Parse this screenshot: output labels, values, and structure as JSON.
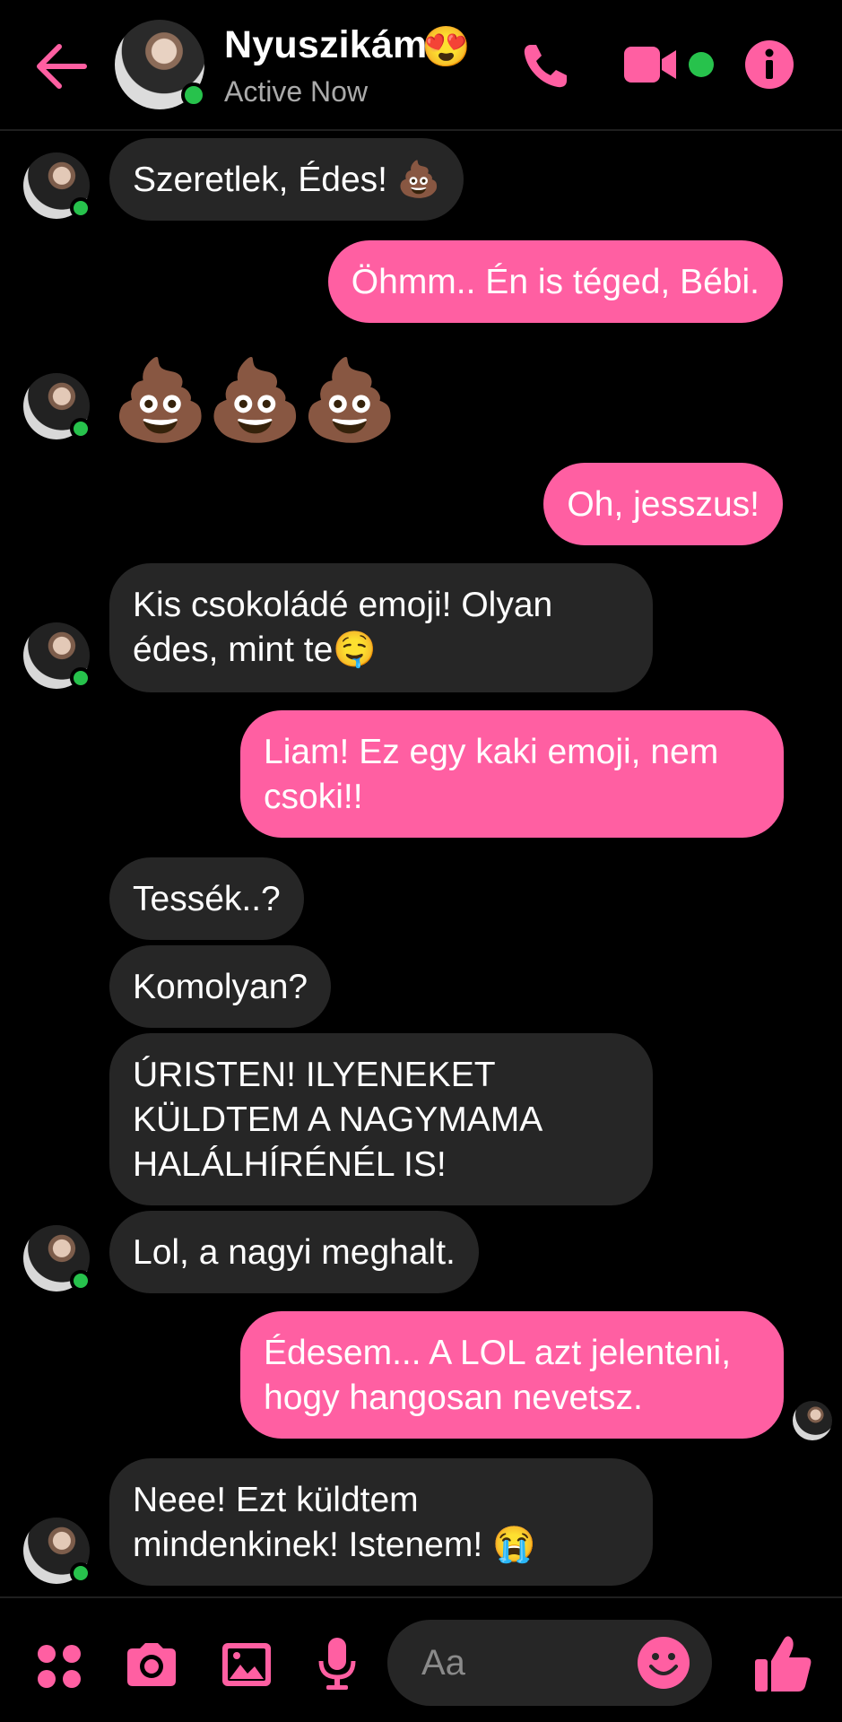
{
  "header": {
    "contact_name": "Nyuszikám",
    "name_emoji": "😍",
    "status": "Active Now"
  },
  "colors": {
    "accent": "#ff5fa2",
    "online": "#27c24c",
    "incoming_bubble": "#262626"
  },
  "messages": [
    {
      "side": "in",
      "text": "Szeretlek, Édes! 💩"
    },
    {
      "side": "out",
      "text": "Öhmm.. Én is téged, Bébi."
    },
    {
      "side": "in",
      "text": "💩💩💩"
    },
    {
      "side": "out",
      "text": "Oh, jesszus!"
    },
    {
      "side": "in",
      "text": "Kis csokoládé emoji! Olyan\nédes, mint te🤤"
    },
    {
      "side": "out",
      "text": "Liam! Ez egy kaki emoji, nem\ncsoki!!"
    },
    {
      "side": "in",
      "text": "Tessék..?"
    },
    {
      "side": "in",
      "text": "Komolyan?"
    },
    {
      "side": "in",
      "text": "ÚRISTEN! ILYENEKET\nKÜLDTEM A NAGYMAMA\nHALÁLHÍRÉNÉL IS!"
    },
    {
      "side": "in",
      "text": "Lol, a nagyi meghalt."
    },
    {
      "side": "out",
      "text": "Édesem... A LOL azt jelenteni,\nhogy hangosan nevetsz."
    },
    {
      "side": "in",
      "text": "Neee! Ezt küldtem\nmindenkinek! Istenem! 😭"
    }
  ],
  "composer": {
    "placeholder": "Aa"
  },
  "icons": [
    "back-arrow-icon",
    "phone-icon",
    "video-camera-icon",
    "info-icon",
    "menu-dots-icon",
    "camera-icon",
    "image-icon",
    "microphone-icon",
    "smiley-icon",
    "thumbs-up-icon"
  ]
}
